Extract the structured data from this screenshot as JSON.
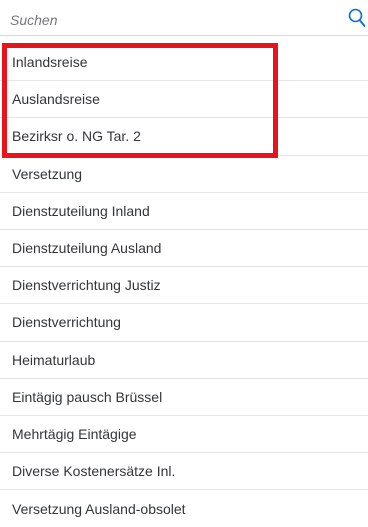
{
  "search": {
    "placeholder": "Suchen",
    "icon": "search-icon"
  },
  "list": {
    "items": [
      {
        "label": "Inlandsreise"
      },
      {
        "label": "Auslandsreise"
      },
      {
        "label": "Bezirksr o. NG Tar. 2"
      },
      {
        "label": "Versetzung"
      },
      {
        "label": "Dienstzuteilung Inland"
      },
      {
        "label": "Dienstzuteilung Ausland"
      },
      {
        "label": "Dienstverrichtung Justiz"
      },
      {
        "label": "Dienstverrichtung"
      },
      {
        "label": "Heimaturlaub"
      },
      {
        "label": "Eintägig pausch Brüssel"
      },
      {
        "label": "Mehrtägig Eintägige"
      },
      {
        "label": "Diverse Kostenersätze Inl."
      },
      {
        "label": "Versetzung Ausland-obsolet"
      }
    ]
  },
  "colors": {
    "highlight": "#e8141c",
    "accent": "#0a6ed1",
    "text": "#32363a"
  }
}
